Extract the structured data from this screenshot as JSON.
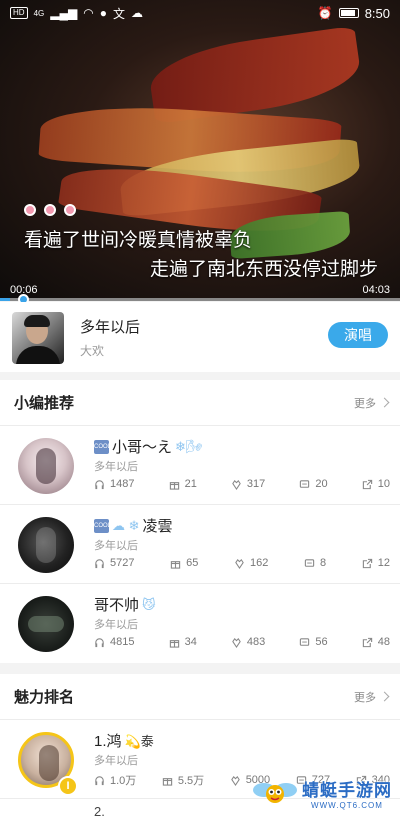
{
  "status_bar": {
    "left_chip": "HD",
    "network": "4G",
    "time": "8:50"
  },
  "video": {
    "lyric_line_1": "看遍了世间冷暖真情被辜负",
    "lyric_line_2": "走遍了南北东西没停过脚步",
    "current_time": "00:06",
    "total_time": "04:03",
    "progress_fraction": 0.025
  },
  "song": {
    "title": "多年以后",
    "artist": "大欢",
    "sing_label": "演唱"
  },
  "editor_picks": {
    "title": "小编推荐",
    "more_label": "更多",
    "items": [
      {
        "badge": "COOL",
        "name": "小哥～え",
        "deco": "❄🌬",
        "song": "多年以后",
        "listens": "1487",
        "gifts": "21",
        "flowers": "317",
        "comments": "20",
        "shares": "10"
      },
      {
        "badge": "COOL",
        "name": "凌雲",
        "deco": "☁ ❄",
        "song": "多年以后",
        "listens": "5727",
        "gifts": "65",
        "flowers": "162",
        "comments": "8",
        "shares": "12"
      },
      {
        "badge": "",
        "name": "哥不帅",
        "deco": "😼",
        "song": "多年以后",
        "listens": "4815",
        "gifts": "34",
        "flowers": "483",
        "comments": "56",
        "shares": "48"
      }
    ]
  },
  "charm_ranking": {
    "title": "魅力排名",
    "more_label": "更多",
    "items": [
      {
        "name": "1.鸿",
        "deco": "💫泰",
        "song": "多年以后",
        "listens": "1.0万",
        "gifts": "5.5万",
        "flowers": "5000",
        "comments": "727",
        "shares": "340"
      }
    ],
    "next_item_partial": "2."
  },
  "watermark": {
    "name": "蜻蜓手游网",
    "url": "WWW.QT6.COM"
  },
  "colors": {
    "accent": "#3aa9ea",
    "badge_gold": "#f5c518"
  }
}
